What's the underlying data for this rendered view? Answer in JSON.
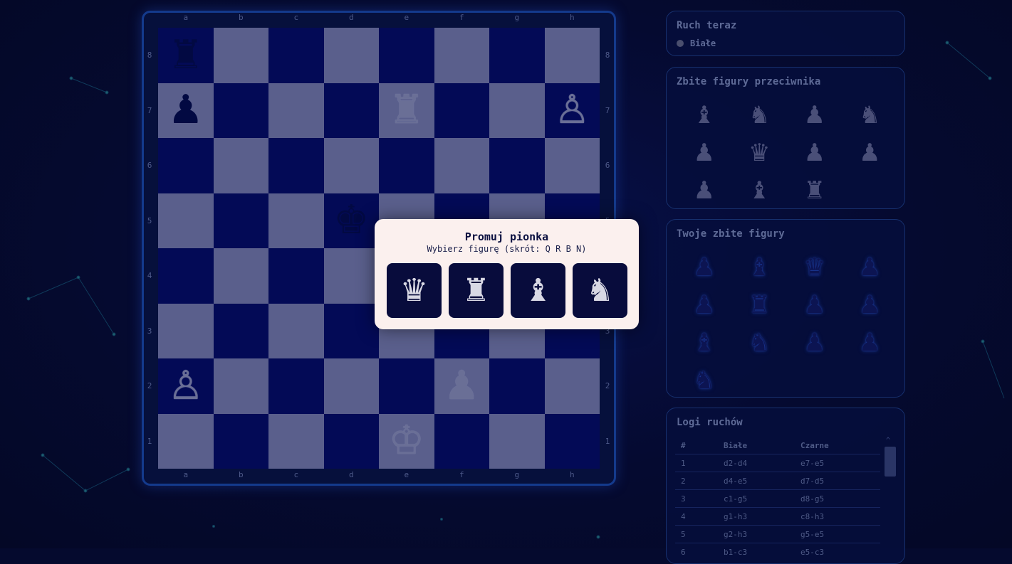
{
  "board": {
    "files": [
      "a",
      "b",
      "c",
      "d",
      "e",
      "f",
      "g",
      "h"
    ],
    "ranks": [
      "8",
      "7",
      "6",
      "5",
      "4",
      "3",
      "2",
      "1"
    ],
    "pieces": [
      {
        "square": "a8",
        "glyph": "♜",
        "color": "black",
        "name": "black-rook"
      },
      {
        "square": "a7",
        "glyph": "♟",
        "color": "black",
        "name": "black-pawn"
      },
      {
        "square": "e7",
        "glyph": "♜",
        "color": "white",
        "name": "white-rook"
      },
      {
        "square": "h7",
        "glyph": "♙",
        "color": "white",
        "name": "white-pawn"
      },
      {
        "square": "d5",
        "glyph": "♚",
        "color": "black",
        "name": "black-king"
      },
      {
        "square": "a2",
        "glyph": "♙",
        "color": "white",
        "name": "white-pawn"
      },
      {
        "square": "f2",
        "glyph": "♟",
        "color": "white",
        "name": "white-pawn"
      },
      {
        "square": "e1",
        "glyph": "♔",
        "color": "white",
        "name": "white-king"
      }
    ]
  },
  "turn": {
    "title": "Ruch teraz",
    "player": "Białe"
  },
  "captured_opponent": {
    "title": "Zbite figury przeciwnika",
    "pieces": [
      "♝",
      "♞",
      "♟",
      "♞",
      "♟",
      "♛",
      "♟",
      "♟",
      "♟",
      "♝",
      "♜"
    ]
  },
  "captured_own": {
    "title": "Twoje zbite figury",
    "pieces": [
      "♟",
      "♝",
      "♛",
      "♟",
      "♟",
      "♜",
      "♟",
      "♟",
      "♝",
      "♞",
      "♟",
      "♟",
      "♞"
    ]
  },
  "log": {
    "title": "Logi ruchów",
    "headers": [
      "#",
      "Białe",
      "Czarne"
    ],
    "rows": [
      [
        "1",
        "d2-d4",
        "e7-e5"
      ],
      [
        "2",
        "d4-e5",
        "d7-d5"
      ],
      [
        "3",
        "c1-g5",
        "d8-g5"
      ],
      [
        "4",
        "g1-h3",
        "c8-h3"
      ],
      [
        "5",
        "g2-h3",
        "g5-e5"
      ],
      [
        "6",
        "b1-c3",
        "e5-c3"
      ]
    ],
    "scroll_up": "^"
  },
  "promotion": {
    "title": "Promuj pionka",
    "subtitle": "Wybierz figurę (skrót: Q R B N)",
    "options": [
      {
        "glyph": "♛",
        "name": "queen"
      },
      {
        "glyph": "♜",
        "name": "rook"
      },
      {
        "glyph": "♝",
        "name": "bishop"
      },
      {
        "glyph": "♞",
        "name": "knight"
      }
    ]
  }
}
